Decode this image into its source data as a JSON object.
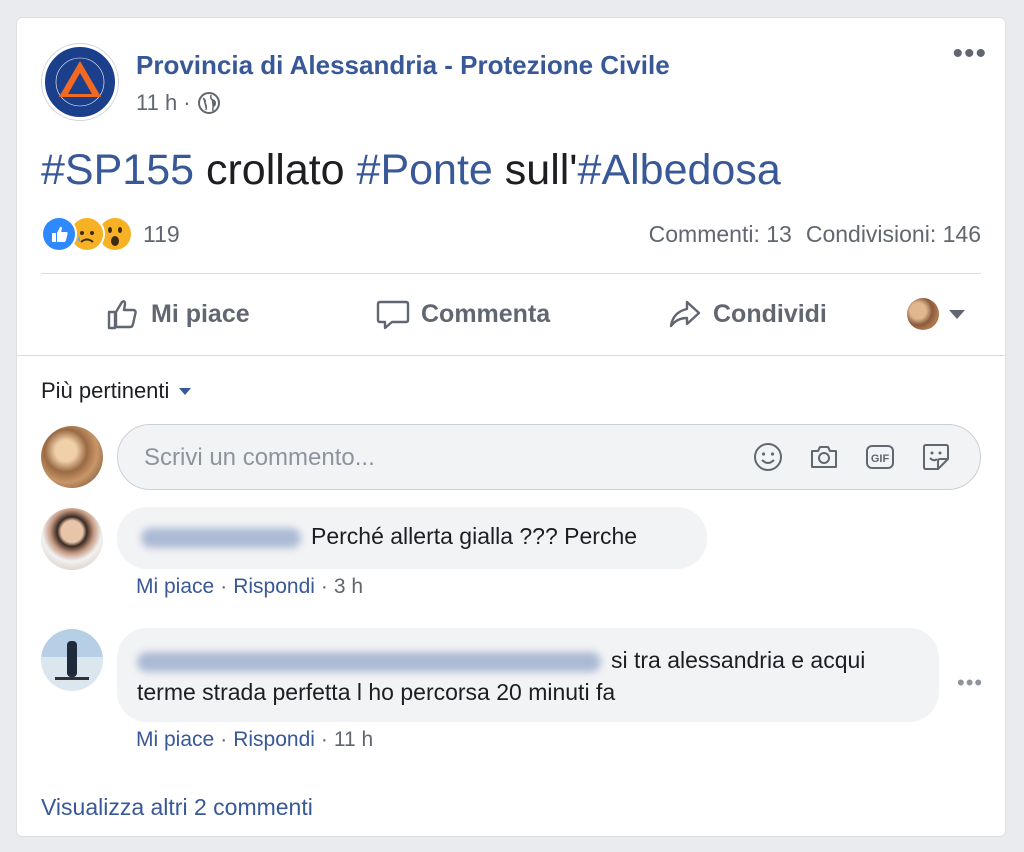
{
  "post": {
    "page_name": "Provincia di Alessandria - Protezione Civile",
    "time": "11 h",
    "time_sep": "·",
    "text_parts": [
      "#SP155",
      " crollato ",
      "#Ponte",
      " sull'",
      "#Albedosa"
    ],
    "logo_text": "PROTEZIONE CIVILE · PROVINCIA DI ALESSANDRIA"
  },
  "reactions": {
    "count": "119",
    "comments": "Commenti: 13",
    "shares": "Condivisioni: 146",
    "colors": {
      "like": "#2e89ff",
      "emoji": "#f7b125"
    }
  },
  "actions": {
    "like": "Mi piace",
    "comment": "Commenta",
    "share": "Condividi"
  },
  "comments_section": {
    "sort_label": "Più pertinenti",
    "placeholder": "Scrivi un commento...",
    "comments": [
      {
        "text": "Perché allerta gialla ??? Perche",
        "like": "Mi piace",
        "reply": "Rispondi",
        "time": "3 h"
      },
      {
        "text": "si tra alessandria e acqui terme strada perfetta l ho percorsa 20 minuti fa",
        "like": "Mi piace",
        "reply": "Rispondi",
        "time": "11 h"
      }
    ],
    "view_more": "Visualizza altri 2 commenti"
  },
  "theme": {
    "link_color": "#385898",
    "secondary_text": "#606770",
    "background": "#e9ebee"
  }
}
